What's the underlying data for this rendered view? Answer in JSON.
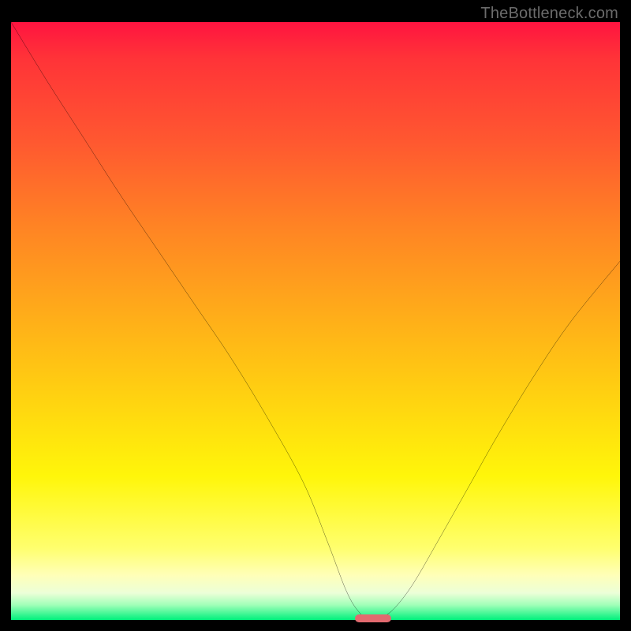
{
  "attribution": "TheBottleneck.com",
  "chart_data": {
    "type": "line",
    "title": "",
    "xlabel": "",
    "ylabel": "",
    "xlim": [
      0,
      100
    ],
    "ylim": [
      0,
      100
    ],
    "x": [
      0,
      6,
      12,
      18,
      24,
      30,
      36,
      42,
      48,
      52,
      55,
      57,
      59,
      61,
      63,
      66,
      70,
      75,
      80,
      86,
      92,
      100
    ],
    "values": [
      100,
      90,
      80.5,
      71,
      62,
      53,
      44,
      34,
      23,
      13,
      5,
      1.5,
      0,
      0.5,
      2,
      6,
      13,
      22,
      31,
      41,
      50,
      60
    ],
    "minimum_marker": {
      "x_start": 56.5,
      "x_end": 62.5,
      "y": 0
    },
    "background_gradient_meaning": "red=high bottleneck, green=optimal"
  },
  "colors": {
    "curve": "#000000",
    "marker": "#e26a6f",
    "frame_bg": "#000000"
  }
}
